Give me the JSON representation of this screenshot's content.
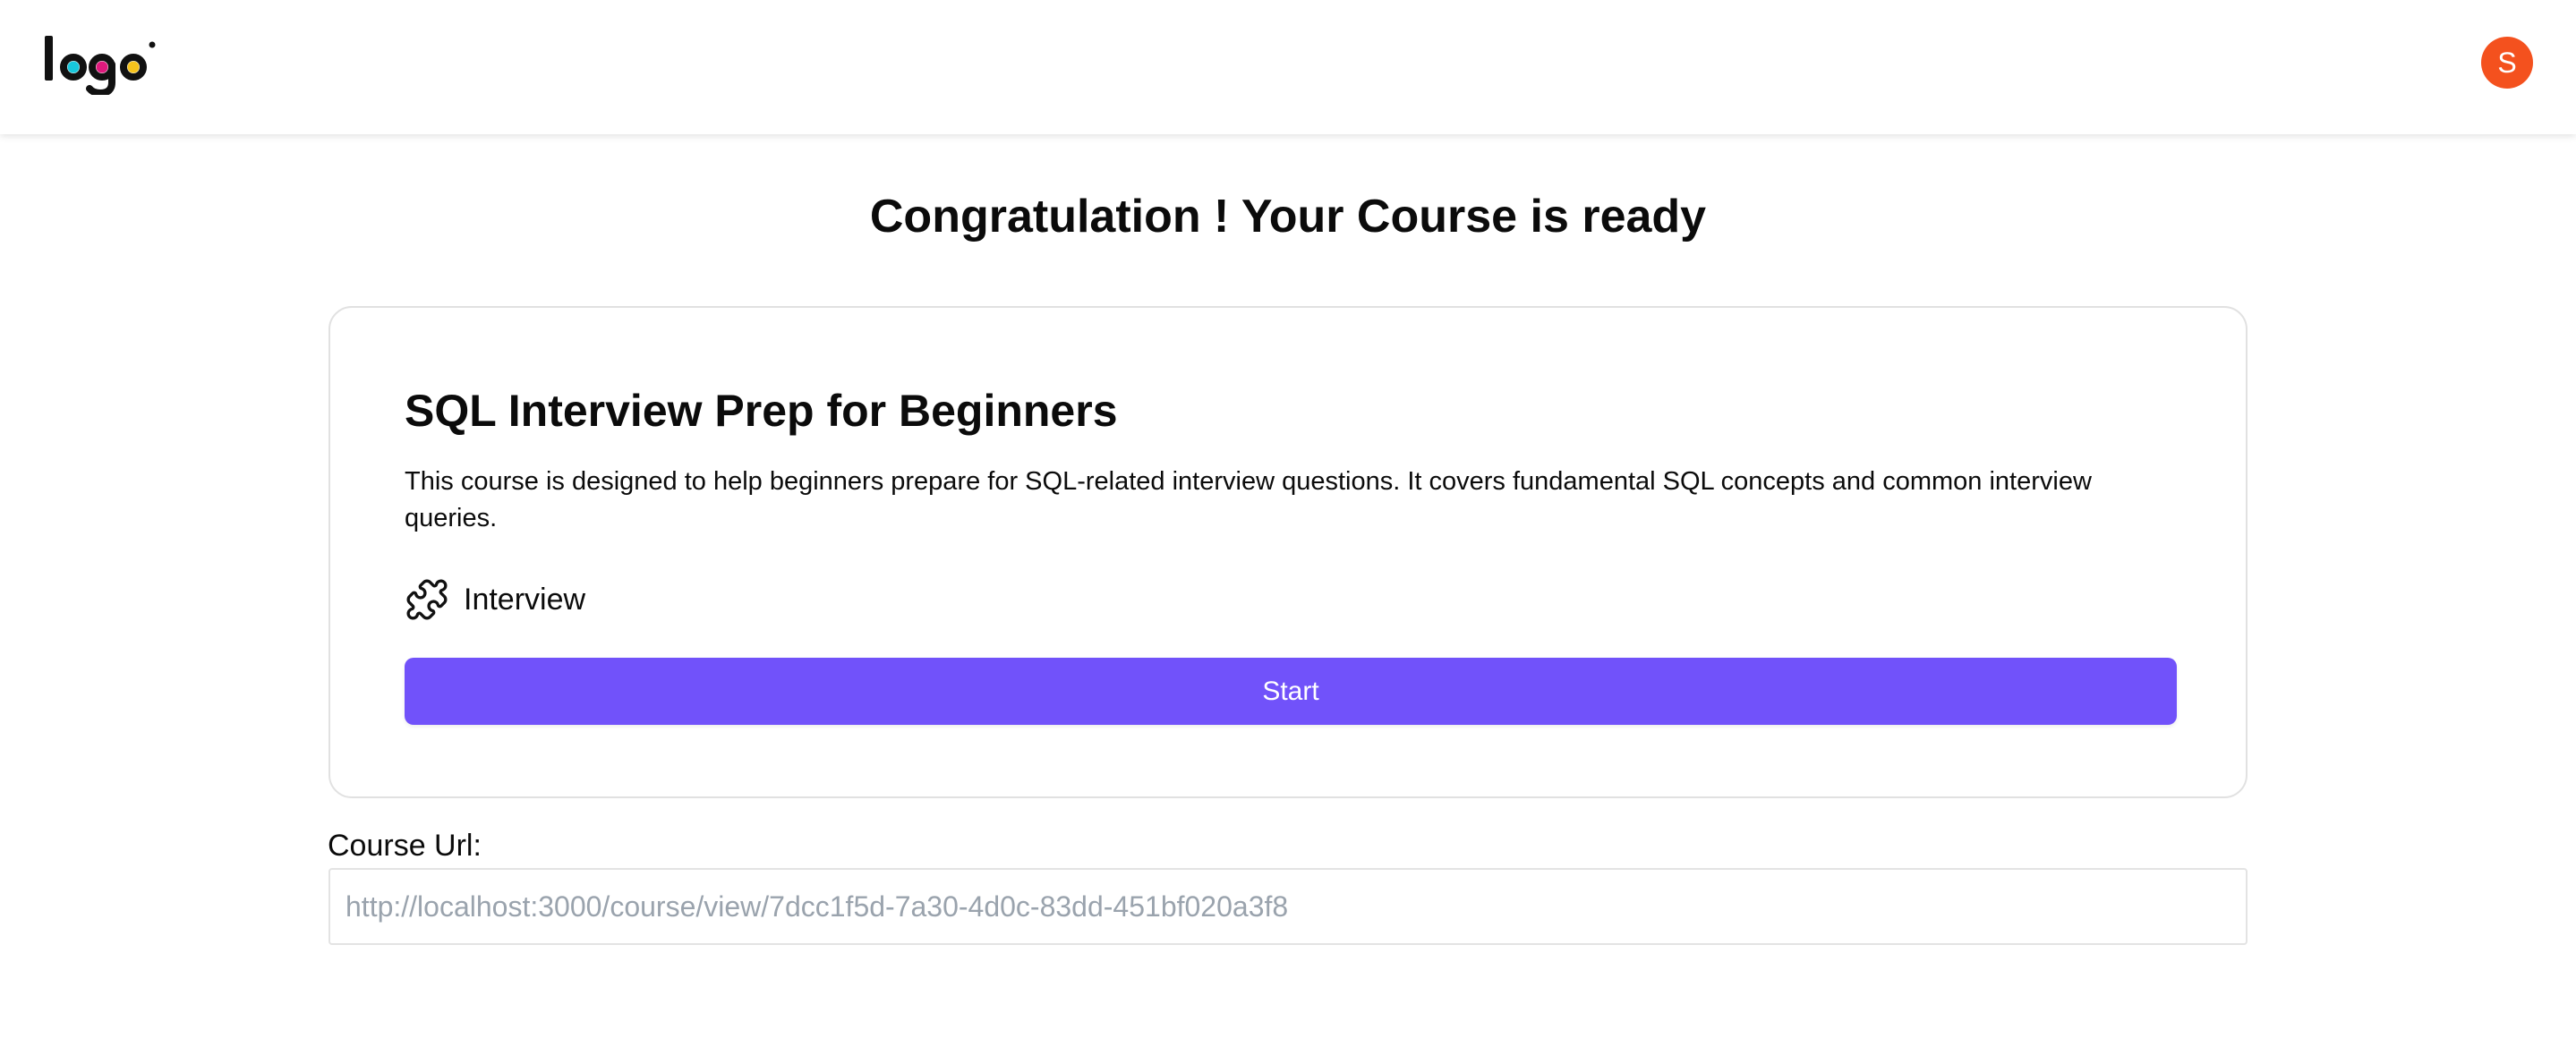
{
  "header": {
    "logo_text": "logo",
    "avatar_initial": "S",
    "avatar_color": "#f4511e"
  },
  "page": {
    "title": "Congratulation ! Your Course is ready"
  },
  "course": {
    "title": "SQL Interview Prep for Beginners",
    "description": "This course is designed to help beginners prepare for SQL-related interview questions. It covers fundamental SQL concepts and common interview queries.",
    "category_icon": "puzzle-icon",
    "category": "Interview",
    "start_label": "Start"
  },
  "course_url": {
    "label": "Course Url:",
    "placeholder": "http://localhost:3000/course/view/7dcc1f5d-7a30-4d0c-83dd-451bf020a3f8"
  },
  "colors": {
    "accent": "#7152fa",
    "logo_dark": "#111111",
    "logo_cyan": "#18c8dc",
    "logo_magenta": "#e0197d",
    "logo_yellow": "#f6c31c"
  }
}
